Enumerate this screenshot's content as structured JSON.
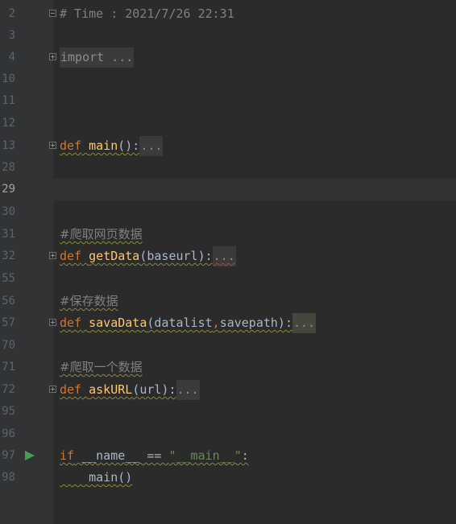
{
  "rows": [
    {
      "line": "2",
      "parts": [
        "# Time : 2021/7/26 22:31"
      ]
    },
    {
      "line": "3",
      "parts": []
    },
    {
      "line": "4",
      "parts": [
        "import ..."
      ]
    },
    {
      "line": "10",
      "parts": []
    },
    {
      "line": "11",
      "parts": []
    },
    {
      "line": "12",
      "parts": []
    },
    {
      "line": "13",
      "parts": [
        "def",
        " ",
        "main",
        "():",
        "..."
      ]
    },
    {
      "line": "28",
      "parts": []
    },
    {
      "line": "29",
      "parts": []
    },
    {
      "line": "30",
      "parts": []
    },
    {
      "line": "31",
      "parts": [
        "#爬取网页数据"
      ]
    },
    {
      "line": "32",
      "parts": [
        "def",
        " ",
        "getData",
        "(baseurl):",
        "..."
      ]
    },
    {
      "line": "55",
      "parts": []
    },
    {
      "line": "56",
      "parts": [
        "#保存数据"
      ]
    },
    {
      "line": "57",
      "parts": [
        "def",
        " ",
        "savaData",
        "(datalist",
        ",",
        "savepath):",
        "..."
      ]
    },
    {
      "line": "70",
      "parts": []
    },
    {
      "line": "71",
      "parts": [
        "#爬取一个数据"
      ]
    },
    {
      "line": "72",
      "parts": [
        "def",
        " ",
        "askURL",
        "(url):",
        "..."
      ]
    },
    {
      "line": "95",
      "parts": []
    },
    {
      "line": "96",
      "parts": []
    },
    {
      "line": "97",
      "parts": [
        "if",
        " __name__ == ",
        "\"__main__\"",
        ":"
      ]
    },
    {
      "line": "98",
      "parts": [
        "    main()"
      ]
    }
  ],
  "colors": {
    "background": "#2b2b2b",
    "gutter": "#313335",
    "current_line": "#323232",
    "keyword": "#cc7832",
    "function": "#ffc66d",
    "string": "#6a8759",
    "comment": "#808080",
    "run_icon": "#499c54"
  },
  "icons": {
    "run": "run-gutter-icon",
    "fold": "fold-toggle-icon"
  }
}
